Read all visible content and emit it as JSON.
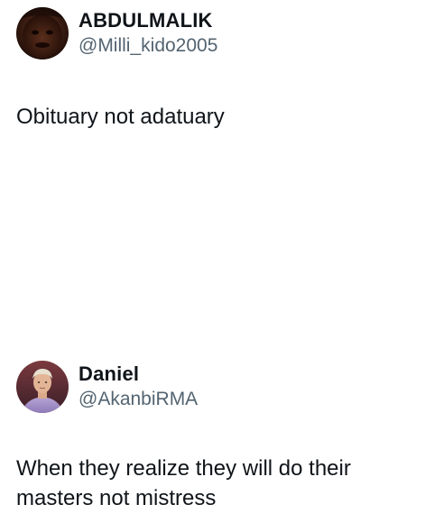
{
  "tweets": [
    {
      "display_name": "ABDULMALIK",
      "handle": "@Milli_kido2005",
      "text": "Obituary not adatuary",
      "avatar_icon": "profile-photo-dark-face"
    },
    {
      "display_name": "Daniel",
      "handle": "@AkanbiRMA",
      "text": "When they realize they will do their masters not mistress",
      "avatar_icon": "profile-photo-footballer"
    }
  ],
  "colors": {
    "text_primary": "#0f1419",
    "text_secondary": "#536471",
    "background": "#ffffff"
  }
}
